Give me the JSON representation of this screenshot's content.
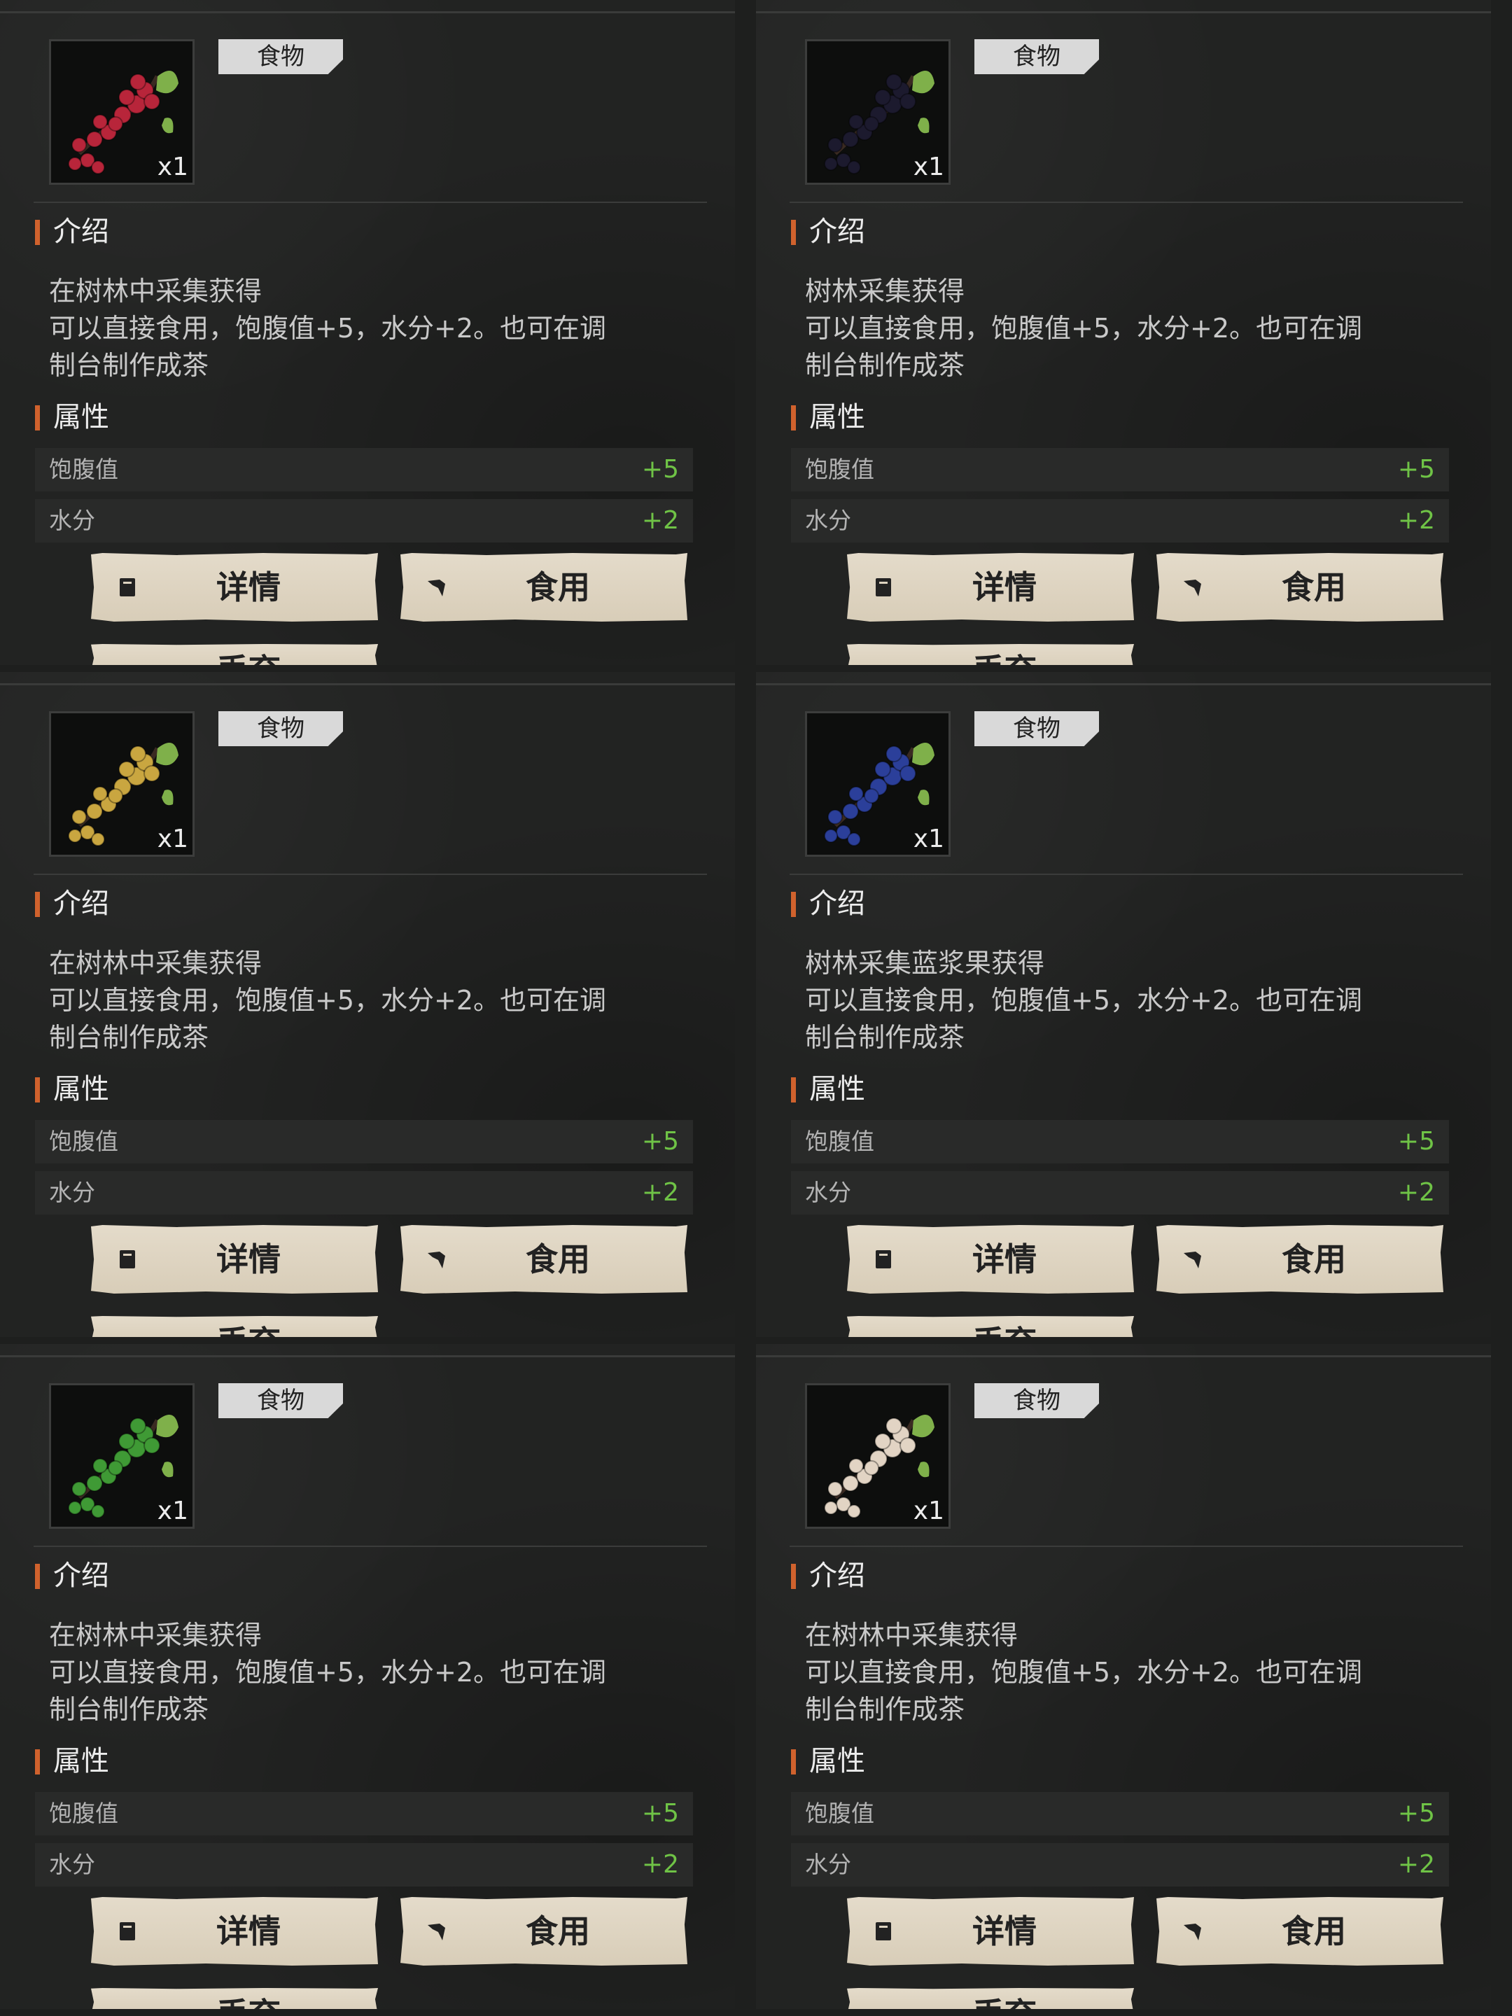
{
  "panels": [
    {
      "category": "食物",
      "qty": "x1",
      "berry_color": "#b8253a",
      "intro_title": "介绍",
      "intro_lines": [
        "在树林中采集获得",
        "可以直接食用，饱腹值+5，水分+2。也可在调",
        "制台制作成茶"
      ],
      "attr_title": "属性",
      "attrs": [
        {
          "name": "饱腹值",
          "value": "+5"
        },
        {
          "name": "水分",
          "value": "+2"
        }
      ],
      "buttons": {
        "details": "详情",
        "eat": "食用",
        "discard": "丢弃"
      }
    },
    {
      "category": "食物",
      "qty": "x1",
      "berry_color": "#1c1a2e",
      "intro_title": "介绍",
      "intro_lines": [
        "树林采集获得",
        "可以直接食用，饱腹值+5，水分+2。也可在调",
        "制台制作成茶"
      ],
      "attr_title": "属性",
      "attrs": [
        {
          "name": "饱腹值",
          "value": "+5"
        },
        {
          "name": "水分",
          "value": "+2"
        }
      ],
      "buttons": {
        "details": "详情",
        "eat": "食用",
        "discard": "丢弃"
      }
    },
    {
      "category": "食物",
      "qty": "x1",
      "berry_color": "#c9a640",
      "intro_title": "介绍",
      "intro_lines": [
        "在树林中采集获得",
        "可以直接食用，饱腹值+5，水分+2。也可在调",
        "制台制作成茶"
      ],
      "attr_title": "属性",
      "attrs": [
        {
          "name": "饱腹值",
          "value": "+5"
        },
        {
          "name": "水分",
          "value": "+2"
        }
      ],
      "buttons": {
        "details": "详情",
        "eat": "食用",
        "discard": "丢弃"
      }
    },
    {
      "category": "食物",
      "qty": "x1",
      "berry_color": "#2b3f9a",
      "intro_title": "介绍",
      "intro_lines": [
        "树林采集蓝浆果获得",
        "可以直接食用，饱腹值+5，水分+2。也可在调",
        "制台制作成茶"
      ],
      "attr_title": "属性",
      "attrs": [
        {
          "name": "饱腹值",
          "value": "+5"
        },
        {
          "name": "水分",
          "value": "+2"
        }
      ],
      "buttons": {
        "details": "详情",
        "eat": "食用",
        "discard": "丢弃"
      }
    },
    {
      "category": "食物",
      "qty": "x1",
      "berry_color": "#3f9a35",
      "intro_title": "介绍",
      "intro_lines": [
        "在树林中采集获得",
        "可以直接食用，饱腹值+5，水分+2。也可在调",
        "制台制作成茶"
      ],
      "attr_title": "属性",
      "attrs": [
        {
          "name": "饱腹值",
          "value": "+5"
        },
        {
          "name": "水分",
          "value": "+2"
        }
      ],
      "buttons": {
        "details": "详情",
        "eat": "食用",
        "discard": "丢弃"
      }
    },
    {
      "category": "食物",
      "qty": "x1",
      "berry_color": "#e2d4c4",
      "intro_title": "介绍",
      "intro_lines": [
        "在树林中采集获得",
        "可以直接食用，饱腹值+5，水分+2。也可在调",
        "制台制作成茶"
      ],
      "attr_title": "属性",
      "attrs": [
        {
          "name": "饱腹值",
          "value": "+5"
        },
        {
          "name": "水分",
          "value": "+2"
        }
      ],
      "buttons": {
        "details": "详情",
        "eat": "食用",
        "discard": "丢弃"
      }
    }
  ],
  "colors": {
    "accent": "#d0622d",
    "positive": "#6fc346",
    "button_bg": "#ddd3c0",
    "tag_bg": "#d9d9d9"
  },
  "icons": {
    "details": "book-icon",
    "eat": "hand-icon",
    "discard": "trash-icon"
  }
}
